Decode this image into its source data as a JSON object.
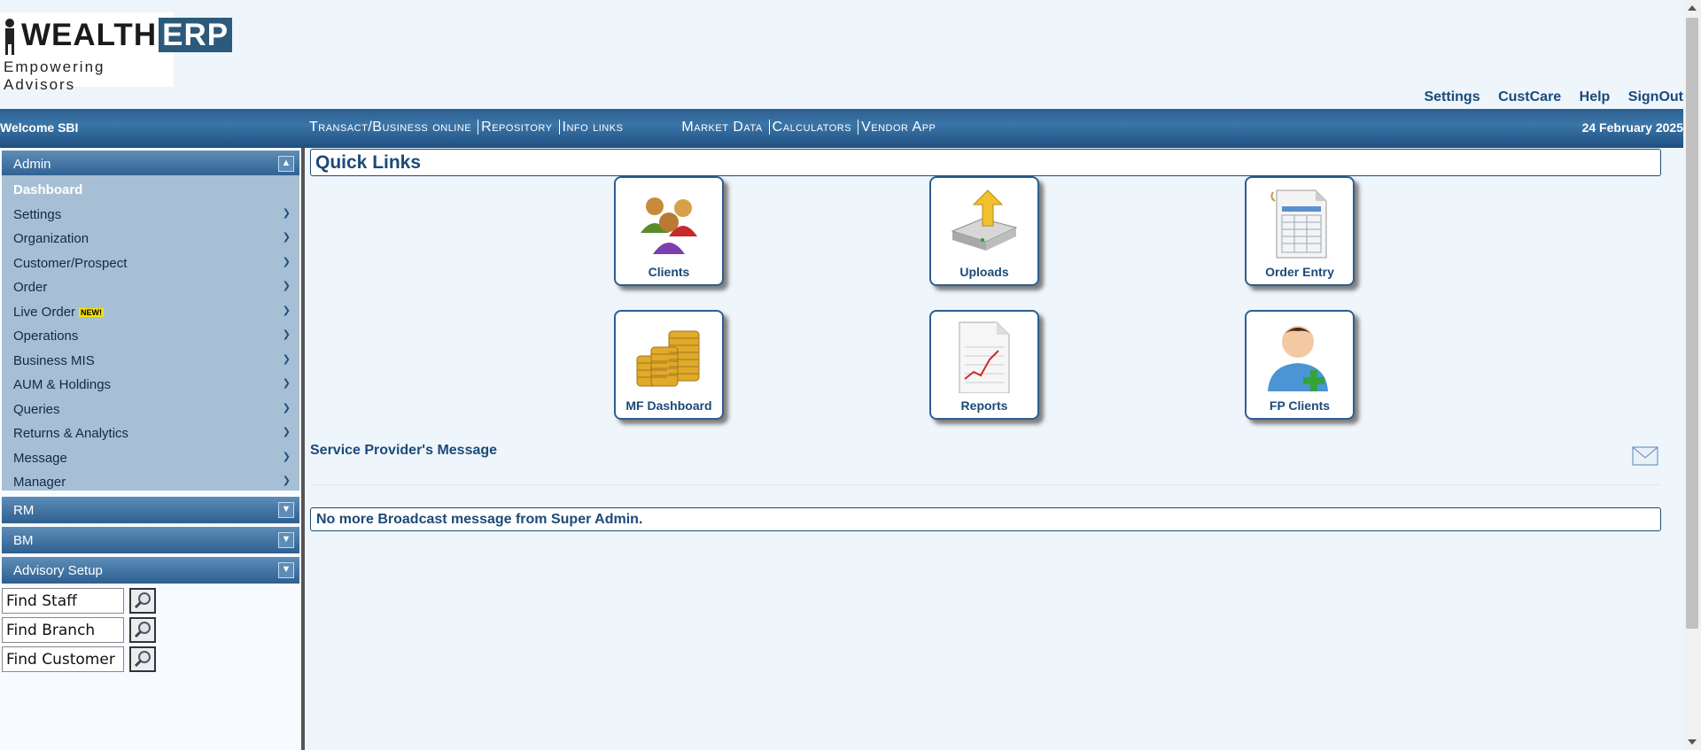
{
  "logo": {
    "brand_left": "WEALTH",
    "brand_right": "ERP",
    "tagline": "Empowering Advisors"
  },
  "top_links": [
    "Settings",
    "CustCare",
    "Help",
    "SignOut"
  ],
  "navbar": {
    "welcome": "Welcome SBI",
    "menu": [
      "Transact/Business online",
      "Repository",
      "Info links",
      "Market Data",
      "Calculators",
      "Vendor App"
    ],
    "date": "24 February 2025"
  },
  "sidebar": {
    "admin_header": "Admin",
    "admin_items": [
      "Dashboard",
      "Settings",
      "Organization",
      "Customer/Prospect",
      "Order",
      "Live Order",
      "Operations",
      "Business MIS",
      "AUM & Holdings",
      "Queries",
      "Returns & Analytics",
      "Message",
      "Manager"
    ],
    "new_badge": "NEW!",
    "rm_header": "RM",
    "bm_header": "BM",
    "advisory_header": "Advisory Setup",
    "find_staff": "Find Staff",
    "find_branch": "Find Branch",
    "find_customer": "Find Customer"
  },
  "main": {
    "quick_links_title": "Quick Links",
    "tiles": [
      "Clients",
      "Uploads",
      "Order Entry",
      "MF Dashboard",
      "Reports",
      "FP Clients"
    ],
    "service_provider_message": "Service Provider's Message",
    "broadcast": "No more Broadcast message from Super Admin."
  },
  "icons": {
    "clients": "people-group-icon",
    "uploads": "upload-drive-icon",
    "order_entry": "form-sheet-icon",
    "mf_dashboard": "coins-stack-icon",
    "reports": "report-chart-icon",
    "fp_clients": "add-person-icon",
    "mail": "envelope-icon",
    "search": "magnifier-icon"
  },
  "colors": {
    "primary": "#1c4a78",
    "navbar": "#2c5f8f",
    "sidebar_list": "#a7bfd4",
    "background": "#eef5fb",
    "new_badge": "#f5e300"
  }
}
